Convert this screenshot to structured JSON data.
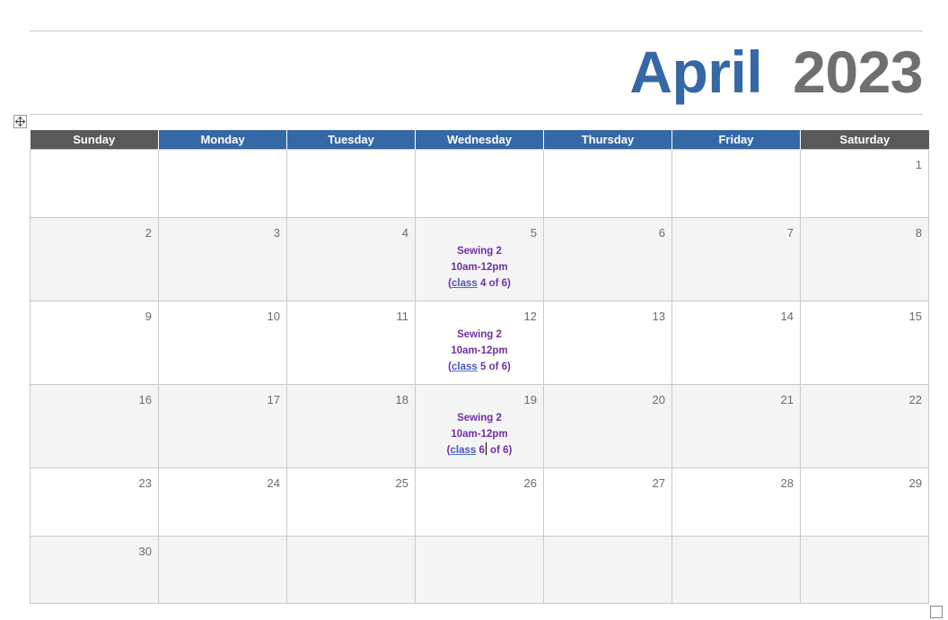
{
  "header": {
    "month": "April",
    "year": "2023"
  },
  "weekdays": [
    "Sunday",
    "Monday",
    "Tuesday",
    "Wednesday",
    "Thursday",
    "Friday",
    "Saturday"
  ],
  "weeks": [
    [
      "",
      "",
      "",
      "",
      "",
      "",
      "1"
    ],
    [
      "2",
      "3",
      "4",
      "5",
      "6",
      "7",
      "8"
    ],
    [
      "9",
      "10",
      "11",
      "12",
      "13",
      "14",
      "15"
    ],
    [
      "16",
      "17",
      "18",
      "19",
      "20",
      "21",
      "22"
    ],
    [
      "23",
      "24",
      "25",
      "26",
      "27",
      "28",
      "29"
    ],
    [
      "30",
      "",
      "",
      "",
      "",
      "",
      ""
    ]
  ],
  "events": {
    "apr5": {
      "title": "Sewing 2",
      "time": "10am-12pm",
      "open": "(",
      "class_word": "class",
      "rest": " 4 of 6)"
    },
    "apr12": {
      "title": "Sewing 2",
      "time": "10am-12pm",
      "open": "(",
      "class_word": "class",
      "rest": " 5 of 6)"
    },
    "apr19": {
      "title": "Sewing 2",
      "time": "10am-12pm",
      "open": "(",
      "class_word": "class",
      "rest_before": " 6",
      "rest_after": " of 6)"
    }
  },
  "colors": {
    "month": "#3568a5",
    "year": "#6f6f6f",
    "weekday_header": "#3568a5",
    "weekend_header": "#595959",
    "event_text": "#7030a0"
  },
  "icons": {
    "table_move": "four-arrows-move-icon",
    "table_resize": "resize-square-icon"
  }
}
